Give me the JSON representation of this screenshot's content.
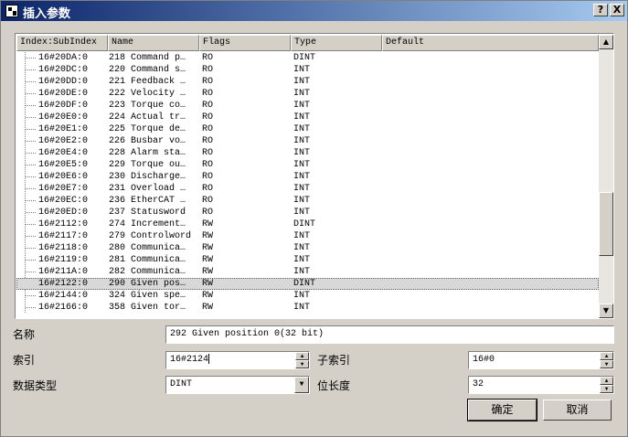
{
  "window": {
    "title": "插入参数",
    "help_glyph": "?",
    "close_glyph": "X"
  },
  "list": {
    "columns": [
      "Index:SubIndex",
      "Name",
      "Flags",
      "Type",
      "Default"
    ],
    "rows": [
      [
        "16#20DA:0",
        "218 Command p…",
        "RO",
        "DINT"
      ],
      [
        "16#20DC:0",
        "220 Command s…",
        "RO",
        "INT"
      ],
      [
        "16#20DD:0",
        "221 Feedback …",
        "RO",
        "INT"
      ],
      [
        "16#20DE:0",
        "222 Velocity …",
        "RO",
        "INT"
      ],
      [
        "16#20DF:0",
        "223 Torque co…",
        "RO",
        "INT"
      ],
      [
        "16#20E0:0",
        "224 Actual tr…",
        "RO",
        "INT"
      ],
      [
        "16#20E1:0",
        "225 Torque de…",
        "RO",
        "INT"
      ],
      [
        "16#20E2:0",
        "226 Busbar vo…",
        "RO",
        "INT"
      ],
      [
        "16#20E4:0",
        "228 Alarm sta…",
        "RO",
        "INT"
      ],
      [
        "16#20E5:0",
        "229 Torque ou…",
        "RO",
        "INT"
      ],
      [
        "16#20E6:0",
        "230 Discharge…",
        "RO",
        "INT"
      ],
      [
        "16#20E7:0",
        "231 Overload …",
        "RO",
        "INT"
      ],
      [
        "16#20EC:0",
        "236 EtherCAT …",
        "RO",
        "INT"
      ],
      [
        "16#20ED:0",
        "237 Statusword",
        "RO",
        "INT"
      ],
      [
        "16#2112:0",
        "274 Increment…",
        "RW",
        "DINT"
      ],
      [
        "16#2117:0",
        "279 Controlword",
        "RW",
        "INT"
      ],
      [
        "16#2118:0",
        "280 Communica…",
        "RW",
        "INT"
      ],
      [
        "16#2119:0",
        "281 Communica…",
        "RW",
        "INT"
      ],
      [
        "16#211A:0",
        "282 Communica…",
        "RW",
        "INT"
      ],
      [
        "16#2122:0",
        "290 Given pos…",
        "RW",
        "DINT"
      ],
      [
        "16#2144:0",
        "324 Given spe…",
        "RW",
        "INT"
      ],
      [
        "16#2166:0",
        "358 Given tor…",
        "RW",
        "INT"
      ]
    ],
    "selected_row": 19,
    "scroll_position": 0.75
  },
  "form": {
    "name_label": "名称",
    "name_value": "292 Given position 0(32 bit)",
    "index_label": "索引",
    "index_value": "16#2124",
    "subindex_label": "子索引",
    "subindex_value": "16#0",
    "datatype_label": "数据类型",
    "datatype_value": "DINT",
    "bitlen_label": "位长度",
    "bitlen_value": "32"
  },
  "buttons": {
    "ok": "确定",
    "cancel": "取消"
  },
  "icons": {
    "up": "▲",
    "down": "▼"
  }
}
